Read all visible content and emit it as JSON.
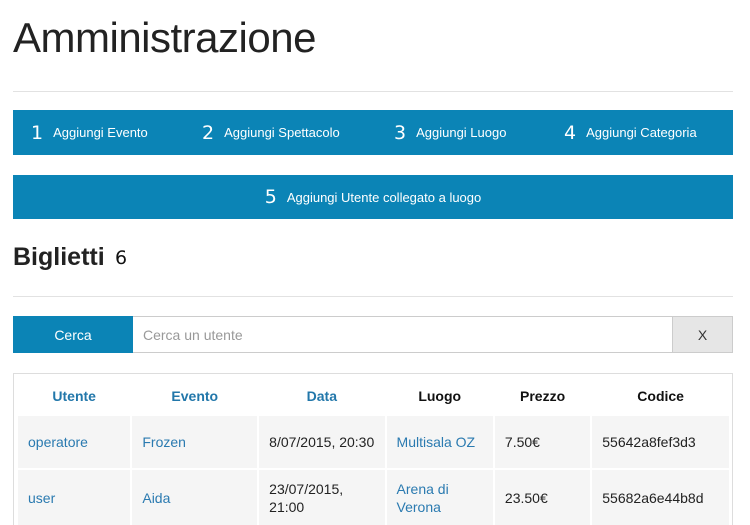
{
  "page": {
    "title": "Amministrazione"
  },
  "nav": {
    "items": [
      {
        "num": "1",
        "label": "Aggiungi Evento"
      },
      {
        "num": "2",
        "label": "Aggiungi Spettacolo"
      },
      {
        "num": "3",
        "label": "Aggiungi Luogo"
      },
      {
        "num": "4",
        "label": "Aggiungi Categoria"
      },
      {
        "num": "5",
        "label": "Aggiungi Utente collegato a luogo"
      }
    ]
  },
  "section": {
    "title": "Biglietti",
    "num": "6"
  },
  "search": {
    "button_label": "Cerca",
    "placeholder": "Cerca un utente",
    "value": "",
    "clear_label": "X"
  },
  "table": {
    "headers": [
      "Utente",
      "Evento",
      "Data",
      "Luogo",
      "Prezzo",
      "Codice"
    ],
    "rows": [
      [
        "operatore",
        "Frozen",
        "8/07/2015, 20:30",
        "Multisala OZ",
        "7.50€",
        "55642a8fef3d3"
      ],
      [
        "user",
        "Aida",
        "23/07/2015, 21:00",
        "Arena di Verona",
        "23.50€",
        "55682a6e44b8d"
      ]
    ]
  },
  "colors": {
    "primary": "#0b84b6",
    "link": "#2a7ab0",
    "cell_bg": "#f5f5f5"
  }
}
